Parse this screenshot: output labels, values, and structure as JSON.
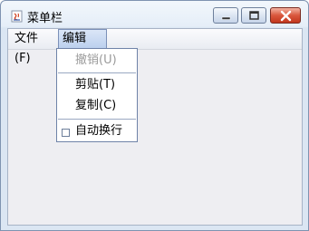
{
  "window": {
    "title": "菜单栏",
    "buttons": {
      "minimize_icon": "minimize-icon",
      "maximize_icon": "maximize-icon",
      "close_icon": "close-icon"
    }
  },
  "menubar": {
    "items": [
      {
        "label": "文件(F)"
      },
      {
        "label": "编辑(E)"
      }
    ]
  },
  "edit_menu": {
    "items": [
      {
        "label": "撤销(U)",
        "enabled": false
      },
      {
        "label": "剪贴(T)",
        "enabled": true
      },
      {
        "label": "复制(C)",
        "enabled": true
      },
      {
        "label": "自动换行",
        "checkbox": true,
        "checked": false
      }
    ]
  },
  "colors": {
    "menu_border": "#6f83a8",
    "disabled_text": "#9a9a9a",
    "close_button": "#c1371d"
  }
}
